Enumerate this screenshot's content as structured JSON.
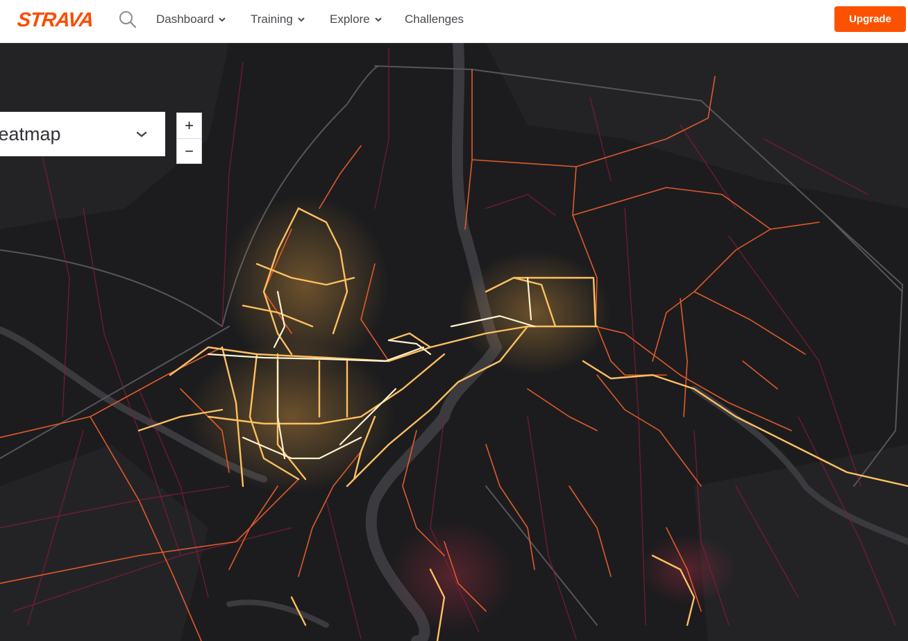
{
  "header": {
    "logo": "STRAVA",
    "nav": [
      {
        "label": "Dashboard",
        "has_dropdown": true
      },
      {
        "label": "Training",
        "has_dropdown": true
      },
      {
        "label": "Explore",
        "has_dropdown": true
      },
      {
        "label": "Challenges",
        "has_dropdown": false
      }
    ],
    "upgrade_label": "Upgrade",
    "icons": {
      "search": "search-icon",
      "dropdown": "chevron-down-icon"
    }
  },
  "map": {
    "layer_value": "Heatmap",
    "zoom_in_label": "+",
    "zoom_out_label": "−"
  },
  "colors": {
    "brand": "#fc4c02",
    "upgrade_bg": "#fc5200",
    "map_bg": "#1c1c1e",
    "heat_low": "#7a1430",
    "heat_mid": "#e0582a",
    "heat_high": "#ffd27a",
    "heat_max": "#fff4d6"
  }
}
